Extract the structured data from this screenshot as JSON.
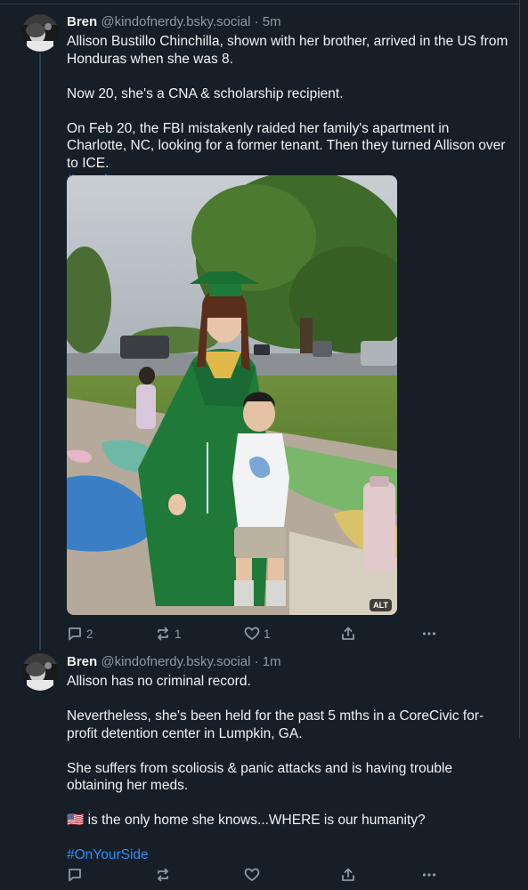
{
  "posts": [
    {
      "author": {
        "display_name": "Bren",
        "handle": "@kindofnerdy.bsky.social"
      },
      "separator": "·",
      "time": "5m",
      "paragraphs": [
        "Allison Bustillo Chinchilla, shown with her brother, arrived in the US from Honduras when she was 8.",
        "Now 20, she's a CNA & scholarship recipient.",
        "On Feb 20, the FBI mistakenly raided her family's apartment in Charlotte, NC, looking for a former tenant. Then they turned Allison over to ICE."
      ],
      "hashtag": "#ncpol",
      "media": {
        "alt_badge": "ALT"
      },
      "actions": {
        "reply_count": "2",
        "repost_count": "1",
        "like_count": "1"
      }
    },
    {
      "author": {
        "display_name": "Bren",
        "handle": "@kindofnerdy.bsky.social"
      },
      "separator": "·",
      "time": "1m",
      "paragraphs": [
        "Allison has no criminal record.",
        "Nevertheless, she's been held for the past 5 mths in a CoreCivic for-profit detention center in Lumpkin, GA.",
        "She suffers from scoliosis & panic attacks and is having trouble obtaining her meds.",
        "🇺🇸 is the only home she knows...WHERE is our humanity?"
      ],
      "hashtag": "#OnYourSide",
      "actions": {
        "reply_count": "",
        "repost_count": "",
        "like_count": ""
      }
    }
  ],
  "icons": {
    "reply": "reply-icon",
    "repost": "repost-icon",
    "like": "heart-icon",
    "share": "share-icon",
    "more": "more-icon"
  },
  "colors": {
    "background": "#161e27",
    "text": "#f1f3f5",
    "muted": "#8d9aa8",
    "link": "#2f8df6",
    "border": "#2e4052"
  }
}
